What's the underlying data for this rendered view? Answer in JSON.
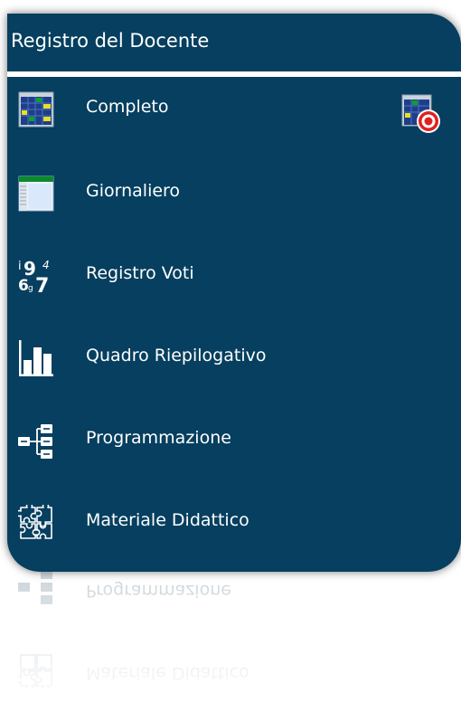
{
  "header": {
    "title": "Registro del Docente"
  },
  "menu": {
    "items": [
      {
        "label": "Completo",
        "icon": "grid-calendar-icon"
      },
      {
        "label": "Giornaliero",
        "icon": "daily-sheet-icon"
      },
      {
        "label": "Registro Voti",
        "icon": "grades-numbers-icon"
      },
      {
        "label": "Quadro Riepilogativo",
        "icon": "bar-chart-icon"
      },
      {
        "label": "Programmazione",
        "icon": "hierarchy-icon"
      },
      {
        "label": "Materiale Didattico",
        "icon": "puzzle-icon"
      }
    ],
    "corner_icon": "calendar-target-icon"
  },
  "colors": {
    "panel": "#063f5f",
    "accent_green": "#0a8a2a",
    "target_red": "#e02020"
  }
}
